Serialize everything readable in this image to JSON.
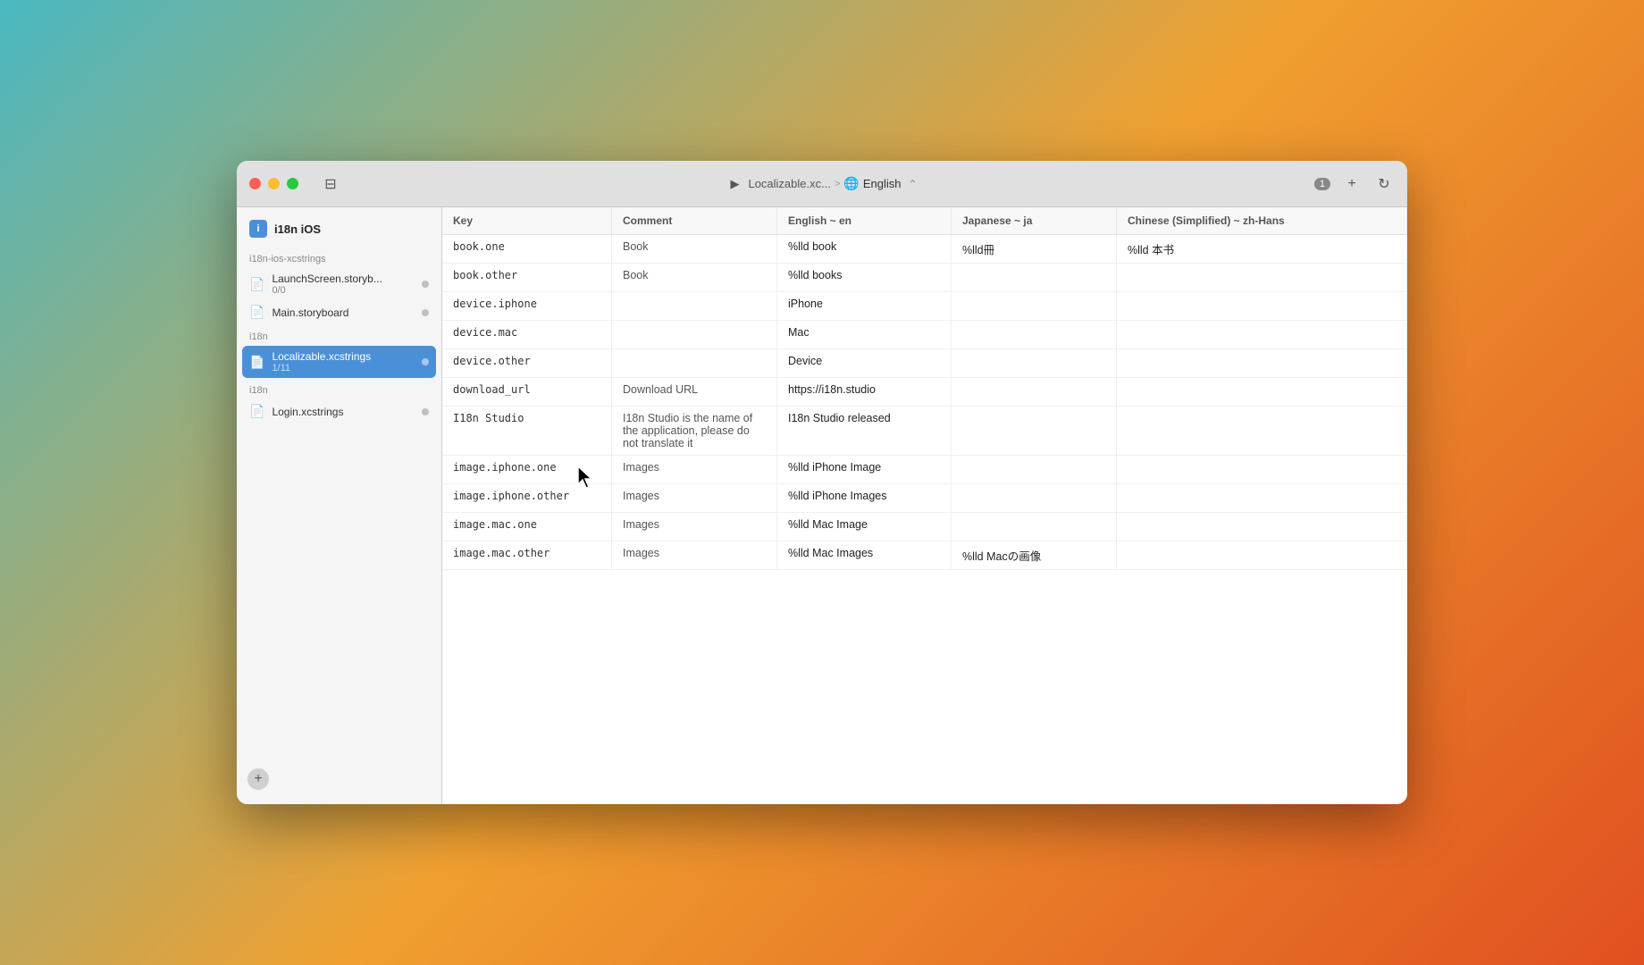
{
  "window": {
    "title": "i18n iOS"
  },
  "titlebar": {
    "play_label": "▶",
    "breadcrumb_file": "Localizable.xc...",
    "breadcrumb_sep": ">",
    "breadcrumb_lang": "English",
    "badge": "1",
    "plus_label": "+",
    "refresh_label": "↻",
    "sidebar_toggle": "⊟"
  },
  "sidebar": {
    "project_label": "i18n iOS",
    "sections": [
      {
        "label": "i18n-ios-xcstrings",
        "items": [
          {
            "name": "LaunchScreen.storyb...",
            "count": "0/0",
            "has_dot": true
          },
          {
            "name": "Main.storyboard",
            "count": "",
            "has_dot": true
          }
        ]
      },
      {
        "label": "i18n",
        "items": [
          {
            "name": "Localizable.xcstrings",
            "count": "1/11",
            "has_dot": true,
            "selected": true
          }
        ]
      },
      {
        "label": "i18n",
        "items": [
          {
            "name": "Login.xcstrings",
            "count": "",
            "has_dot": true
          }
        ]
      }
    ],
    "add_button_label": "+"
  },
  "table": {
    "columns": [
      {
        "id": "key",
        "label": "Key"
      },
      {
        "id": "comment",
        "label": "Comment"
      },
      {
        "id": "english",
        "label": "English ~ en"
      },
      {
        "id": "japanese",
        "label": "Japanese ~ ja"
      },
      {
        "id": "chinese",
        "label": "Chinese (Simplified) ~ zh-Hans"
      }
    ],
    "rows": [
      {
        "key": "book.one",
        "comment": "Book",
        "english": "%lld book",
        "japanese": "%lld冊",
        "chinese": "%lld 本书"
      },
      {
        "key": "book.other",
        "comment": "Book",
        "english": "%lld books",
        "japanese": "",
        "chinese": ""
      },
      {
        "key": "device.iphone",
        "comment": "",
        "english": "iPhone",
        "japanese": "",
        "chinese": ""
      },
      {
        "key": "device.mac",
        "comment": "",
        "english": "Mac",
        "japanese": "",
        "chinese": ""
      },
      {
        "key": "device.other",
        "comment": "",
        "english": "Device",
        "japanese": "",
        "chinese": ""
      },
      {
        "key": "download_url",
        "comment": "Download URL",
        "english": "https://i18n.studio",
        "japanese": "",
        "chinese": ""
      },
      {
        "key": "I18n Studio",
        "comment": "I18n Studio is the name of the application, please do not translate it",
        "english": "I18n Studio released",
        "japanese": "",
        "chinese": ""
      },
      {
        "key": "image.iphone.one",
        "comment": "Images",
        "english": "%lld iPhone Image",
        "japanese": "",
        "chinese": ""
      },
      {
        "key": "image.iphone.other",
        "comment": "Images",
        "english": "%lld iPhone Images",
        "japanese": "",
        "chinese": ""
      },
      {
        "key": "image.mac.one",
        "comment": "Images",
        "english": "%lld Mac Image",
        "japanese": "",
        "chinese": ""
      },
      {
        "key": "image.mac.other",
        "comment": "Images",
        "english": "%lld Mac Images",
        "japanese": "%lld Macの画像",
        "chinese": ""
      }
    ]
  }
}
